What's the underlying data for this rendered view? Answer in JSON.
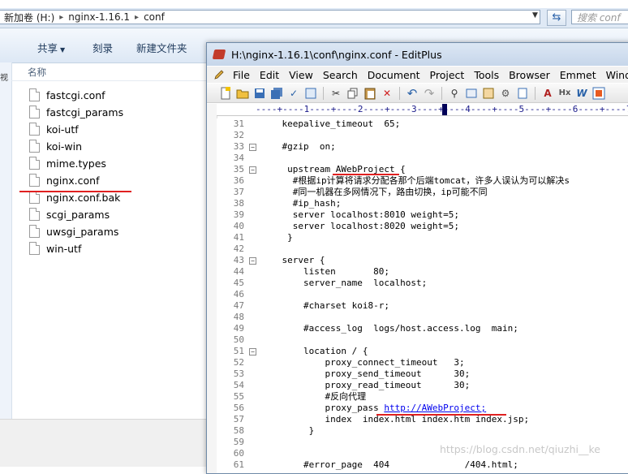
{
  "explorer": {
    "address_parts": [
      "新加卷 (H:)",
      "nginx-1.16.1",
      "conf"
    ],
    "search_placeholder": "搜索 conf",
    "toolbar": {
      "share": "共享",
      "burn": "刻录",
      "new_folder": "新建文件夹"
    },
    "nav_char": "视",
    "column_name": "名称",
    "files": [
      "fastcgi.conf",
      "fastcgi_params",
      "koi-utf",
      "koi-win",
      "mime.types",
      "nginx.conf",
      "nginx.conf.bak",
      "scgi_params",
      "uwsgi_params",
      "win-utf"
    ]
  },
  "editplus": {
    "title": "H:\\nginx-1.16.1\\conf\\nginx.conf - EditPlus",
    "menu": [
      "File",
      "Edit",
      "View",
      "Search",
      "Document",
      "Project",
      "Tools",
      "Browser",
      "Emmet",
      "Wind"
    ],
    "ruler": "----+----1----+----2----+----3----+----4----+----5----+----6----+----7",
    "lines": [
      {
        "n": "31",
        "text": "    keepalive_timeout  65;"
      },
      {
        "n": "32",
        "text": ""
      },
      {
        "n": "33",
        "text": "    #gzip  on;",
        "fold": "⊟"
      },
      {
        "n": "34",
        "text": ""
      },
      {
        "n": "35",
        "text": "     upstream AWebProject {",
        "fold": "⊟"
      },
      {
        "n": "36",
        "text": "      #根据ip计算将请求分配各那个后端tomcat，许多人误认为可以解决s"
      },
      {
        "n": "37",
        "text": "      #同一机器在多网情况下，路由切换，ip可能不同"
      },
      {
        "n": "38",
        "text": "      #ip_hash;"
      },
      {
        "n": "39",
        "text": "      server localhost:8010 weight=5;"
      },
      {
        "n": "40",
        "text": "      server localhost:8020 weight=5;"
      },
      {
        "n": "41",
        "text": "     }"
      },
      {
        "n": "42",
        "text": ""
      },
      {
        "n": "43",
        "text": "    server {",
        "fold": "⊟"
      },
      {
        "n": "44",
        "text": "        listen       80;"
      },
      {
        "n": "45",
        "text": "        server_name  localhost;"
      },
      {
        "n": "46",
        "text": ""
      },
      {
        "n": "47",
        "text": "        #charset koi8-r;"
      },
      {
        "n": "48",
        "text": ""
      },
      {
        "n": "49",
        "text": "        #access_log  logs/host.access.log  main;"
      },
      {
        "n": "50",
        "text": ""
      },
      {
        "n": "51",
        "text": "        location / {",
        "fold": "⊟"
      },
      {
        "n": "52",
        "text": "            proxy_connect_timeout   3;"
      },
      {
        "n": "53",
        "text": "            proxy_send_timeout      30;"
      },
      {
        "n": "54",
        "text": "            proxy_read_timeout      30;"
      },
      {
        "n": "55",
        "text": "            #反向代理"
      },
      {
        "n": "56",
        "text": "            proxy_pass ",
        "link": "http://AWebProject;"
      },
      {
        "n": "57",
        "text": "            index  index.html index.htm index.jsp;"
      },
      {
        "n": "58",
        "text": "         }"
      },
      {
        "n": "59",
        "text": ""
      },
      {
        "n": "60",
        "text": ""
      },
      {
        "n": "61",
        "text": "        #error_page  404              /404.html;"
      }
    ]
  },
  "watermark": "https://blog.csdn.net/qiuzhi__ke"
}
